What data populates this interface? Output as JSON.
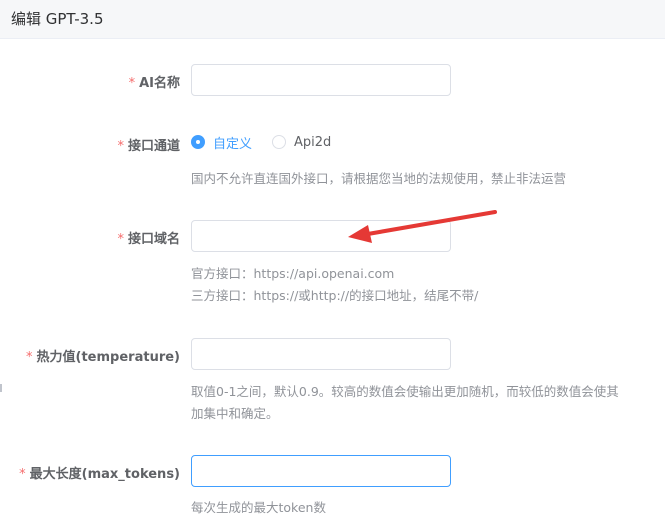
{
  "header": {
    "title": "编辑 GPT-3.5"
  },
  "fields": {
    "ai_name": {
      "required": "*",
      "label": "AI名称",
      "value": ""
    },
    "channel": {
      "required": "*",
      "label": "接口通道",
      "options": [
        {
          "label": "自定义",
          "checked": true
        },
        {
          "label": "Api2d",
          "checked": false
        }
      ],
      "hint": "国内不允许直连国外接口，请根据您当地的法规使用，禁止非法运营"
    },
    "domain": {
      "required": "*",
      "label": "接口域名",
      "value": "",
      "hint1": "官方接口：https://api.openai.com",
      "hint2": "三方接口：https://或http://的接口地址，结尾不带/"
    },
    "temperature": {
      "required": "*",
      "label": "热力值(temperature)",
      "value": "",
      "hint1": "取值0-1之间，默认0.9。较高的数值会使输出更加随机，而较低的数值会使其",
      "hint2": "加集中和确定。"
    },
    "max_tokens": {
      "required": "*",
      "label": "最大长度(max_tokens)",
      "value": "",
      "hint": "每次生成的最大token数"
    }
  },
  "colors": {
    "accent": "#409eff",
    "required": "#f56c6c",
    "arrow": "#e53935"
  }
}
